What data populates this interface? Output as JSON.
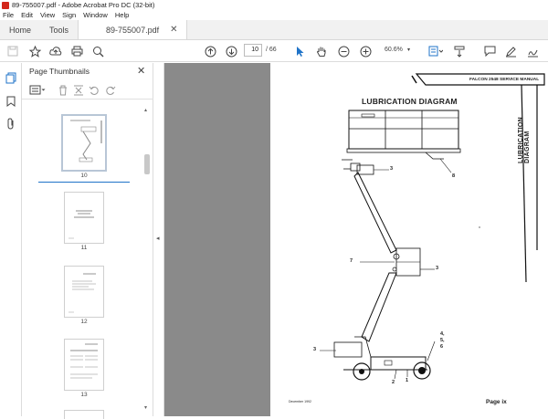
{
  "window": {
    "title": "89-755007.pdf - Adobe Acrobat Pro DC (32-bit)"
  },
  "menu": [
    "File",
    "Edit",
    "View",
    "Sign",
    "Window",
    "Help"
  ],
  "tabs": {
    "home": "Home",
    "tools": "Tools",
    "document": "89-755007.pdf"
  },
  "toolbar": {
    "page_current": "10",
    "page_total": "/ 66",
    "zoom": "60.6%"
  },
  "panel": {
    "title": "Page Thumbnails"
  },
  "thumbnails": [
    {
      "label": "10",
      "selected": true
    },
    {
      "label": "11",
      "selected": false
    },
    {
      "label": "12",
      "selected": false
    },
    {
      "label": "13",
      "selected": false
    }
  ],
  "document": {
    "heading": "LUBRICATION DIAGRAM",
    "manual_title": "FALCON 2548 SERVICE MANUAL",
    "side_label": "LUBRICATION DIAGRAM",
    "footer_date": "December 1992",
    "page_label": "Page ix",
    "callouts": [
      "3",
      "8",
      "7",
      "3",
      "3",
      "4,",
      "5,",
      "6",
      "2",
      "1"
    ]
  },
  "colors": {
    "accent": "#1f73c8",
    "viewer_bg": "#8a8a8a",
    "app_red": "#d3271b"
  }
}
